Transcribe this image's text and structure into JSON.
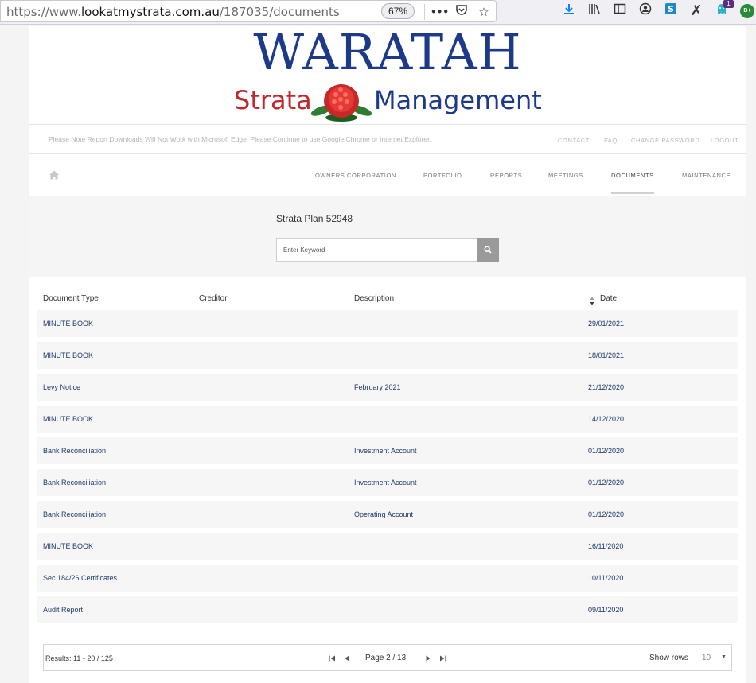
{
  "browser": {
    "url_prefix": "https://www.",
    "url_host": "lookatmystrata.com.au",
    "url_path": "/187035/documents",
    "zoom": "67%",
    "more_label": "•••",
    "notification_count": "1",
    "profile_label": "B+"
  },
  "brand": {
    "logo_top": "WARATAH",
    "logo_left": "Strata",
    "logo_right": "Management",
    "primary_color": "#1d3a8a",
    "accent_color": "#c0282d"
  },
  "notice": {
    "text": "Please Note Report Downloads Will Not Work with Microsoft Edge. Please Continue to use Google Chrome or Internet Explorer.",
    "links": [
      "CONTACT",
      "FAQ",
      "CHANGE PASSWORD",
      "LOGOUT"
    ]
  },
  "nav": {
    "items": [
      "OWNERS CORPORATION",
      "PORTFOLIO",
      "REPORTS",
      "MEETINGS",
      "DOCUMENTS",
      "MAINTENANCE"
    ],
    "active": "DOCUMENTS"
  },
  "search": {
    "title": "Strata Plan 52948",
    "placeholder": "Enter Keyword"
  },
  "table": {
    "headers": [
      "Document Type",
      "Creditor",
      "Description",
      "Date"
    ],
    "rows": [
      {
        "type": "MINUTE BOOK",
        "creditor": "",
        "description": "",
        "date": "29/01/2021"
      },
      {
        "type": "MINUTE BOOK",
        "creditor": "",
        "description": "",
        "date": "18/01/2021"
      },
      {
        "type": "Levy Notice",
        "creditor": "",
        "description": "February 2021",
        "date": "21/12/2020"
      },
      {
        "type": "MINUTE BOOK",
        "creditor": "",
        "description": "",
        "date": "14/12/2020"
      },
      {
        "type": "Bank Reconciliation",
        "creditor": "",
        "description": "Investment Account",
        "date": "01/12/2020"
      },
      {
        "type": "Bank Reconciliation",
        "creditor": "",
        "description": "Investment Account",
        "date": "01/12/2020"
      },
      {
        "type": "Bank Reconciliation",
        "creditor": "",
        "description": "Operating Account",
        "date": "01/12/2020"
      },
      {
        "type": "MINUTE BOOK",
        "creditor": "",
        "description": "",
        "date": "16/11/2020"
      },
      {
        "type": "Sec 184/26 Certificates",
        "creditor": "",
        "description": "",
        "date": "10/11/2020"
      },
      {
        "type": "Audit Report",
        "creditor": "",
        "description": "",
        "date": "09/11/2020"
      }
    ]
  },
  "pagination": {
    "results_label": "Results:",
    "results_value": "11 - 20 / 125",
    "page_label": "Page",
    "page_value": "2 / 13",
    "show_rows_label": "Show rows",
    "rows_value": "10"
  }
}
